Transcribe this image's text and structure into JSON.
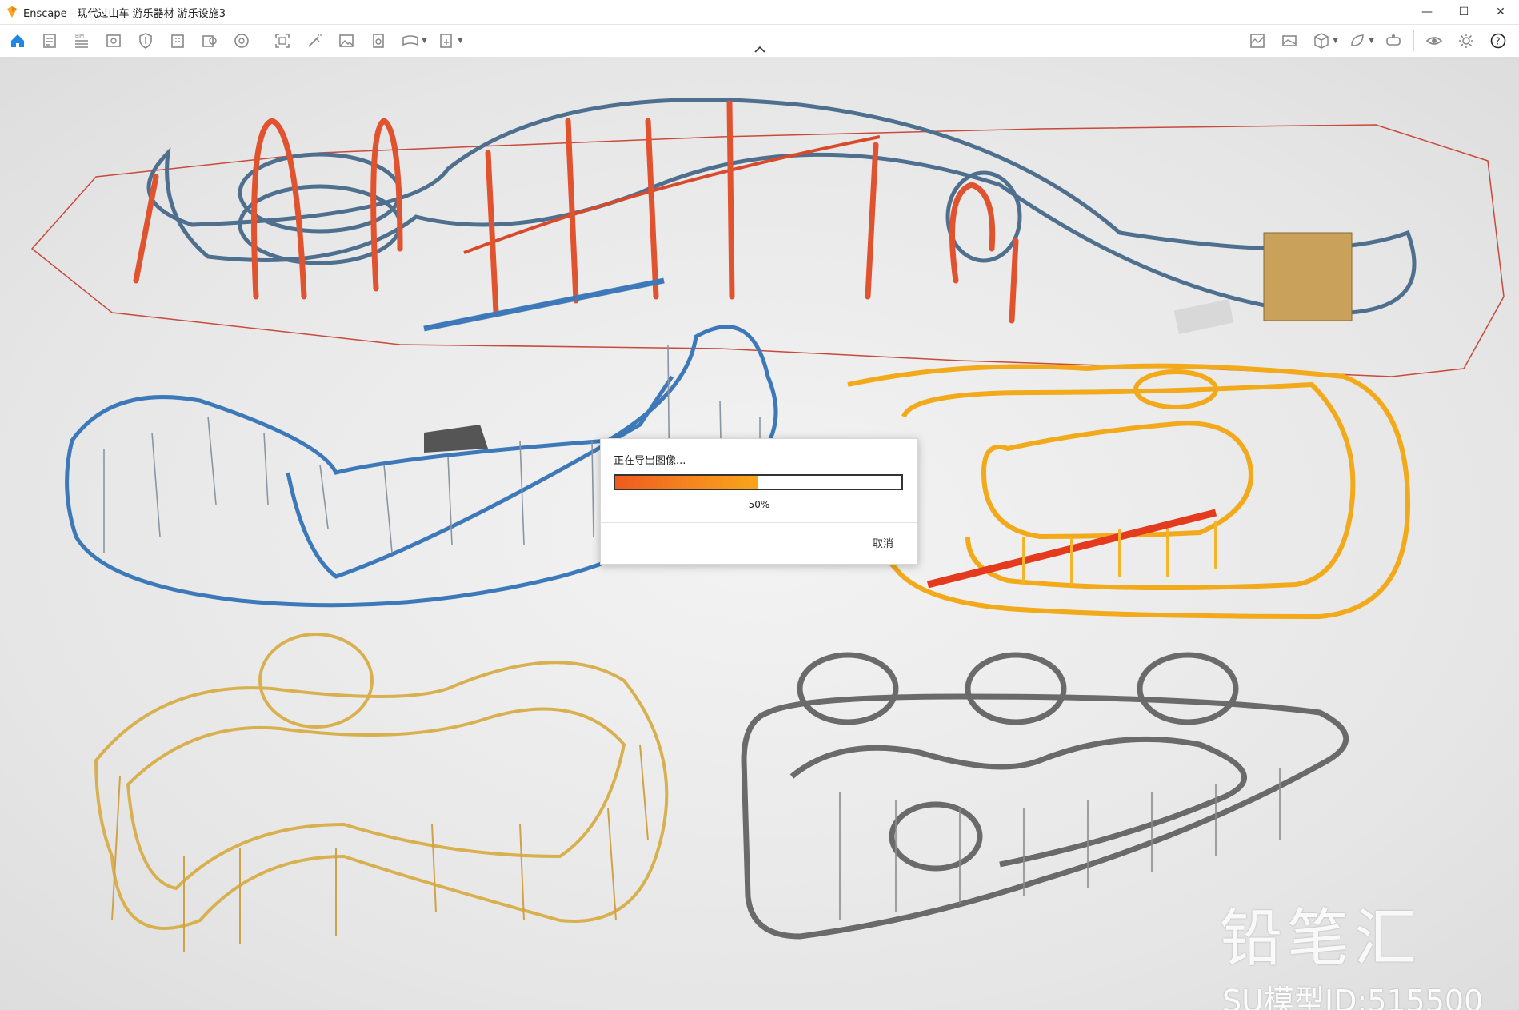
{
  "window": {
    "title": "Enscape - 现代过山车 游乐器材 游乐设施3",
    "minimize_glyph": "—",
    "maximize_glyph": "☐",
    "close_glyph": "✕",
    "accent": "#f5a623"
  },
  "toolbar": {
    "left_icons": [
      "home-icon",
      "sketch-icon",
      "bim-list-icon",
      "view-icon",
      "settings-shield-icon",
      "building-icon",
      "asset-library-icon",
      "atmosphere-icon",
      "screenshot-icon",
      "magic-wand-icon",
      "image-icon",
      "batch-render-icon",
      "panorama-icon",
      "export-icon"
    ],
    "right_icons": [
      "map-icon",
      "gallery-icon",
      "box-icon",
      "material-icon",
      "vr-headset-icon",
      "eye-icon",
      "gear-icon",
      "help-icon"
    ],
    "bim_label": "BIM"
  },
  "dialog": {
    "title": "正在导出图像...",
    "progress_percent": 50,
    "progress_label": "50%",
    "cancel_label": "取消"
  },
  "watermark": {
    "brand": "铅笔汇",
    "model_id": "SU模型ID:515500"
  }
}
